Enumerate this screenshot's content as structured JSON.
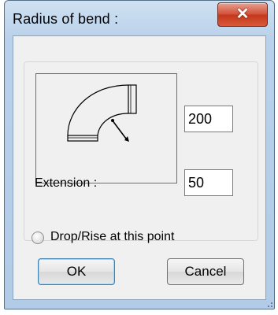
{
  "window": {
    "title": "Radius of bend :"
  },
  "titlebar": {
    "close_icon_glyph": "✕"
  },
  "fields": {
    "radius_value": "200",
    "extension_label": "Extension :",
    "extension_value": "50"
  },
  "options": {
    "drop_rise_label": "Drop/Rise at this point"
  },
  "buttons": {
    "ok": "OK",
    "cancel": "Cancel"
  },
  "colors": {
    "close_button": "#d3513a",
    "frame": "#b9d1ea",
    "client": "#f0f0f0"
  }
}
